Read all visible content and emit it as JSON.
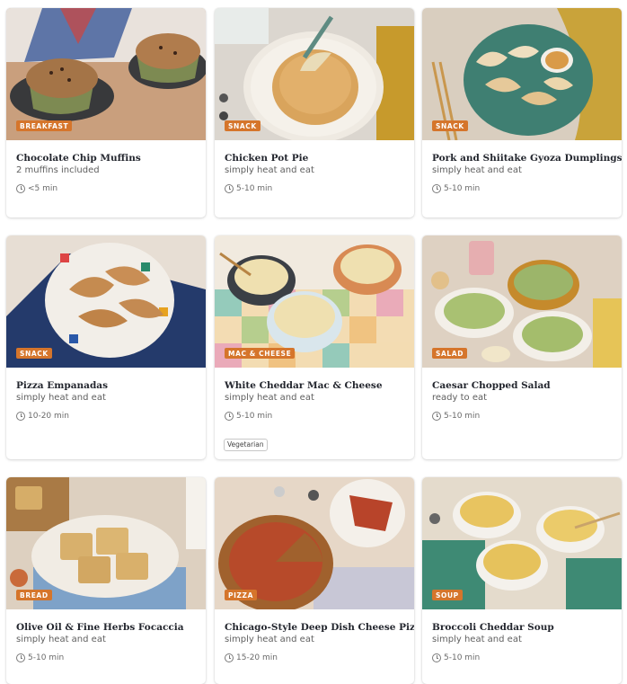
{
  "recipes": [
    {
      "title": "Chocolate Chip Muffins",
      "subtitle": "2 muffins included",
      "category": "BREAKFAST",
      "time": "<5 min",
      "tags": []
    },
    {
      "title": "Chicken Pot Pie",
      "subtitle": "simply heat and eat",
      "category": "SNACK",
      "time": "5-10 min",
      "tags": []
    },
    {
      "title": "Pork and Shiitake Gyoza Dumplings",
      "subtitle": "simply heat and eat",
      "category": "SNACK",
      "time": "5-10 min",
      "tags": []
    },
    {
      "title": "Pizza Empanadas",
      "subtitle": "simply heat and eat",
      "category": "SNACK",
      "time": "10-20 min",
      "tags": []
    },
    {
      "title": "White Cheddar Mac & Cheese",
      "subtitle": "simply heat and eat",
      "category": "MAC & CHEESE",
      "time": "5-10 min",
      "tags": [
        "Vegetarian"
      ]
    },
    {
      "title": "Caesar Chopped Salad",
      "subtitle": "ready to eat",
      "category": "SALAD",
      "time": "5-10 min",
      "tags": []
    },
    {
      "title": "Olive Oil & Fine Herbs Focaccia",
      "subtitle": "simply heat and eat",
      "category": "BREAD",
      "time": "5-10 min",
      "tags": []
    },
    {
      "title": "Chicago-Style Deep Dish Cheese Pizza",
      "subtitle": "simply heat and eat",
      "category": "PIZZA",
      "time": "15-20 min",
      "tags": []
    },
    {
      "title": "Broccoli Cheddar Soup",
      "subtitle": "simply heat and eat",
      "category": "SOUP",
      "time": "5-10 min",
      "tags": []
    }
  ],
  "colors": {
    "badge": "#d5752b",
    "title": "#23262e"
  }
}
